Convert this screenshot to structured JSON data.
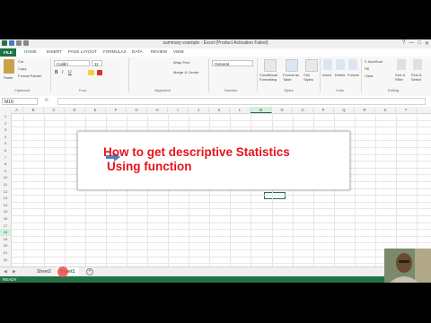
{
  "window": {
    "title": "summary example - Excel (Product Activation Failed)",
    "controls": [
      "?",
      "—",
      "□",
      "✕"
    ]
  },
  "ribbon_tabs": [
    "FILE",
    "HOME",
    "INSERT",
    "PAGE LAYOUT",
    "FORMULAS",
    "DATA",
    "REVIEW",
    "VIEW"
  ],
  "active_tab": "HOME",
  "ribbon": {
    "clipboard": {
      "cut": "Cut",
      "copy": "Copy",
      "format_painter": "Format Painter",
      "group": "Clipboard",
      "paste": "Paste"
    },
    "font": {
      "name": "Calibri",
      "size": "11",
      "bold": "B",
      "italic": "I",
      "underline": "U",
      "group": "Font"
    },
    "alignment": {
      "wrap": "Wrap Text",
      "merge": "Merge & Center",
      "group": "Alignment"
    },
    "number": {
      "format": "General",
      "group": "Number"
    },
    "styles": {
      "conditional": "Conditional Formatting",
      "format_table": "Format as Table",
      "cell_styles": "Cell Styles",
      "group": "Styles"
    },
    "cells": {
      "insert": "Insert",
      "delete": "Delete",
      "format": "Format",
      "group": "Cells"
    },
    "editing": {
      "autosum": "AutoSum",
      "fill": "Fill",
      "clear": "Clear",
      "sort": "Sort & Filter",
      "find": "Find & Select",
      "group": "Editing"
    }
  },
  "formula_bar": {
    "name_box": "M18",
    "fx": "fx",
    "value": ""
  },
  "columns": [
    "A",
    "B",
    "C",
    "D",
    "E",
    "F",
    "G",
    "H",
    "I",
    "J",
    "K",
    "L",
    "M",
    "N",
    "O",
    "P",
    "Q",
    "R",
    "S",
    "T"
  ],
  "selected_column": "M",
  "rows": [
    "1",
    "2",
    "3",
    "4",
    "5",
    "6",
    "7",
    "8",
    "9",
    "10",
    "11",
    "12",
    "13",
    "14",
    "15",
    "16",
    "17",
    "18",
    "19",
    "20",
    "21",
    "22"
  ],
  "selected_row": "18",
  "callout": {
    "line1": "How to get descriptive Statistics",
    "line2": "Using function",
    "color": "#e8131c",
    "arrow_color": "#4f81bd"
  },
  "sheets": [
    "Sheet2",
    "Sheet1"
  ],
  "active_sheet": "Sheet1",
  "status": {
    "ready": "READY"
  },
  "accent": "#217346"
}
